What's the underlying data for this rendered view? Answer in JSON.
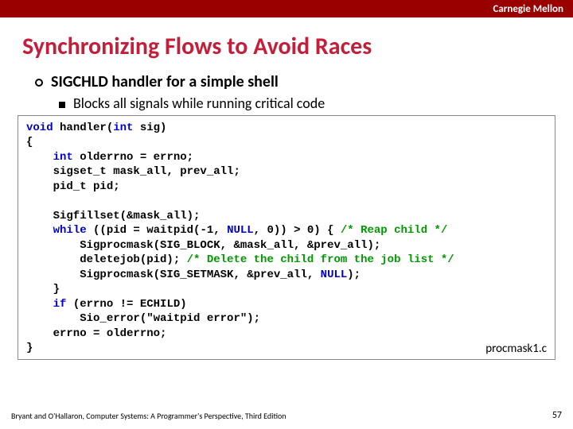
{
  "header": {
    "brand": "Carnegie Mellon"
  },
  "title": "Synchronizing Flows to Avoid Races",
  "bullets": {
    "b1": "SIGCHLD handler for a simple shell",
    "b2": "Blocks all signals while running critical code"
  },
  "code": {
    "l01a": "void",
    "l01b": " handler(",
    "l01c": "int",
    "l01d": " sig)",
    "l02": "{",
    "l03a": "    ",
    "l03b": "int",
    "l03c": " olderrno = errno;",
    "l04": "    sigset_t mask_all, prev_all;",
    "l05": "    pid_t pid;",
    "l06": "",
    "l07": "    Sigfillset(&mask_all);",
    "l08a": "    ",
    "l08b": "while",
    "l08c": " ((pid = waitpid(-1, ",
    "l08d": "NULL",
    "l08e": ", 0)) > 0) { ",
    "l08f": "/* Reap child */",
    "l09": "        Sigprocmask(SIG_BLOCK, &mask_all, &prev_all);",
    "l10a": "        deletejob(pid); ",
    "l10b": "/* Delete the child from the job list */",
    "l11a": "        Sigprocmask(SIG_SETMASK, &prev_all, ",
    "l11b": "NULL",
    "l11c": ");",
    "l12": "    }",
    "l13a": "    ",
    "l13b": "if",
    "l13c": " (errno != ECHILD)",
    "l14": "        Sio_error(\"waitpid error\");",
    "l15": "    errno = olderrno;",
    "l16": "}",
    "srcfile": "procmask1.c"
  },
  "footer": {
    "credit": "Bryant and O'Hallaron, Computer Systems: A Programmer's Perspective, Third Edition",
    "pagenum": "57"
  }
}
